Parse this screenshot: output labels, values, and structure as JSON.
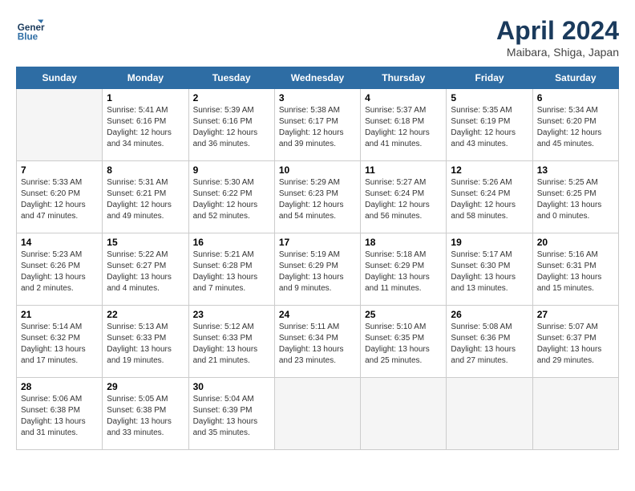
{
  "header": {
    "logo_line1": "General",
    "logo_line2": "Blue",
    "month_title": "April 2024",
    "location": "Maibara, Shiga, Japan"
  },
  "weekdays": [
    "Sunday",
    "Monday",
    "Tuesday",
    "Wednesday",
    "Thursday",
    "Friday",
    "Saturday"
  ],
  "weeks": [
    [
      {
        "day": "",
        "info": ""
      },
      {
        "day": "1",
        "info": "Sunrise: 5:41 AM\nSunset: 6:16 PM\nDaylight: 12 hours\nand 34 minutes."
      },
      {
        "day": "2",
        "info": "Sunrise: 5:39 AM\nSunset: 6:16 PM\nDaylight: 12 hours\nand 36 minutes."
      },
      {
        "day": "3",
        "info": "Sunrise: 5:38 AM\nSunset: 6:17 PM\nDaylight: 12 hours\nand 39 minutes."
      },
      {
        "day": "4",
        "info": "Sunrise: 5:37 AM\nSunset: 6:18 PM\nDaylight: 12 hours\nand 41 minutes."
      },
      {
        "day": "5",
        "info": "Sunrise: 5:35 AM\nSunset: 6:19 PM\nDaylight: 12 hours\nand 43 minutes."
      },
      {
        "day": "6",
        "info": "Sunrise: 5:34 AM\nSunset: 6:20 PM\nDaylight: 12 hours\nand 45 minutes."
      }
    ],
    [
      {
        "day": "7",
        "info": "Sunrise: 5:33 AM\nSunset: 6:20 PM\nDaylight: 12 hours\nand 47 minutes."
      },
      {
        "day": "8",
        "info": "Sunrise: 5:31 AM\nSunset: 6:21 PM\nDaylight: 12 hours\nand 49 minutes."
      },
      {
        "day": "9",
        "info": "Sunrise: 5:30 AM\nSunset: 6:22 PM\nDaylight: 12 hours\nand 52 minutes."
      },
      {
        "day": "10",
        "info": "Sunrise: 5:29 AM\nSunset: 6:23 PM\nDaylight: 12 hours\nand 54 minutes."
      },
      {
        "day": "11",
        "info": "Sunrise: 5:27 AM\nSunset: 6:24 PM\nDaylight: 12 hours\nand 56 minutes."
      },
      {
        "day": "12",
        "info": "Sunrise: 5:26 AM\nSunset: 6:24 PM\nDaylight: 12 hours\nand 58 minutes."
      },
      {
        "day": "13",
        "info": "Sunrise: 5:25 AM\nSunset: 6:25 PM\nDaylight: 13 hours\nand 0 minutes."
      }
    ],
    [
      {
        "day": "14",
        "info": "Sunrise: 5:23 AM\nSunset: 6:26 PM\nDaylight: 13 hours\nand 2 minutes."
      },
      {
        "day": "15",
        "info": "Sunrise: 5:22 AM\nSunset: 6:27 PM\nDaylight: 13 hours\nand 4 minutes."
      },
      {
        "day": "16",
        "info": "Sunrise: 5:21 AM\nSunset: 6:28 PM\nDaylight: 13 hours\nand 7 minutes."
      },
      {
        "day": "17",
        "info": "Sunrise: 5:19 AM\nSunset: 6:29 PM\nDaylight: 13 hours\nand 9 minutes."
      },
      {
        "day": "18",
        "info": "Sunrise: 5:18 AM\nSunset: 6:29 PM\nDaylight: 13 hours\nand 11 minutes."
      },
      {
        "day": "19",
        "info": "Sunrise: 5:17 AM\nSunset: 6:30 PM\nDaylight: 13 hours\nand 13 minutes."
      },
      {
        "day": "20",
        "info": "Sunrise: 5:16 AM\nSunset: 6:31 PM\nDaylight: 13 hours\nand 15 minutes."
      }
    ],
    [
      {
        "day": "21",
        "info": "Sunrise: 5:14 AM\nSunset: 6:32 PM\nDaylight: 13 hours\nand 17 minutes."
      },
      {
        "day": "22",
        "info": "Sunrise: 5:13 AM\nSunset: 6:33 PM\nDaylight: 13 hours\nand 19 minutes."
      },
      {
        "day": "23",
        "info": "Sunrise: 5:12 AM\nSunset: 6:33 PM\nDaylight: 13 hours\nand 21 minutes."
      },
      {
        "day": "24",
        "info": "Sunrise: 5:11 AM\nSunset: 6:34 PM\nDaylight: 13 hours\nand 23 minutes."
      },
      {
        "day": "25",
        "info": "Sunrise: 5:10 AM\nSunset: 6:35 PM\nDaylight: 13 hours\nand 25 minutes."
      },
      {
        "day": "26",
        "info": "Sunrise: 5:08 AM\nSunset: 6:36 PM\nDaylight: 13 hours\nand 27 minutes."
      },
      {
        "day": "27",
        "info": "Sunrise: 5:07 AM\nSunset: 6:37 PM\nDaylight: 13 hours\nand 29 minutes."
      }
    ],
    [
      {
        "day": "28",
        "info": "Sunrise: 5:06 AM\nSunset: 6:38 PM\nDaylight: 13 hours\nand 31 minutes."
      },
      {
        "day": "29",
        "info": "Sunrise: 5:05 AM\nSunset: 6:38 PM\nDaylight: 13 hours\nand 33 minutes."
      },
      {
        "day": "30",
        "info": "Sunrise: 5:04 AM\nSunset: 6:39 PM\nDaylight: 13 hours\nand 35 minutes."
      },
      {
        "day": "",
        "info": ""
      },
      {
        "day": "",
        "info": ""
      },
      {
        "day": "",
        "info": ""
      },
      {
        "day": "",
        "info": ""
      }
    ]
  ]
}
